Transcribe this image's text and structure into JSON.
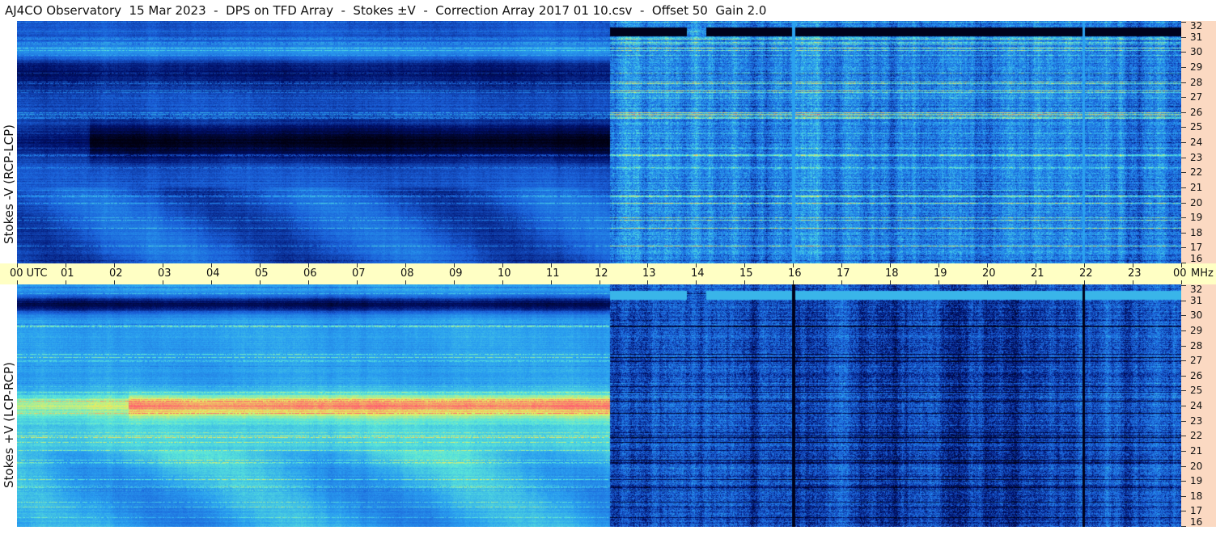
{
  "header": {
    "title": "AJ4CO Observatory  15 Mar 2023  -  DPS on TFD Array  -  Stokes ±V  -  Correction Array 2017 01 10.csv  -  Offset 50  Gain 2.0"
  },
  "chart_data": [
    {
      "type": "heatmap",
      "name": "Stokes -V (RCP-LCP)",
      "ylabel": "Stokes -V (RCP-LCP)",
      "xlabel": "UTC",
      "x_ticks": [
        "00 UTC",
        "01",
        "02",
        "03",
        "04",
        "05",
        "06",
        "07",
        "08",
        "09",
        "10",
        "11",
        "12",
        "13",
        "14",
        "15",
        "16",
        "17",
        "18",
        "19",
        "20",
        "21",
        "22",
        "23",
        "00"
      ],
      "x_range_hours": [
        0,
        24
      ],
      "y_unit": "MHz",
      "y_ticks": [
        16,
        17,
        18,
        19,
        20,
        21,
        22,
        23,
        24,
        25,
        26,
        27,
        28,
        29,
        30,
        31,
        32
      ],
      "y_range_mhz": [
        16,
        32
      ],
      "colormap": [
        "#000010",
        "#00106a",
        "#1a5fd8",
        "#2aa0f0",
        "#5ce8d8",
        "#e8f060",
        "#ff6070"
      ]
    },
    {
      "type": "heatmap",
      "name": "Stokes +V (LCP-RCP)",
      "ylabel": "Stokes +V (LCP-RCP)",
      "xlabel": "UTC",
      "x_ticks": [
        "00 UTC",
        "01",
        "02",
        "03",
        "04",
        "05",
        "06",
        "07",
        "08",
        "09",
        "10",
        "11",
        "12",
        "13",
        "14",
        "15",
        "16",
        "17",
        "18",
        "19",
        "20",
        "21",
        "22",
        "23",
        "00"
      ],
      "x_range_hours": [
        0,
        24
      ],
      "y_unit": "MHz",
      "y_ticks": [
        16,
        17,
        18,
        19,
        20,
        21,
        22,
        23,
        24,
        25,
        26,
        27,
        28,
        29,
        30,
        31,
        32
      ],
      "y_range_mhz": [
        16,
        32
      ],
      "colormap": [
        "#000010",
        "#00106a",
        "#1a5fd8",
        "#2aa0f0",
        "#5ce8d8",
        "#e8f060",
        "#ff6070"
      ]
    }
  ],
  "time_axis": {
    "labels": [
      "00 UTC",
      "01",
      "02",
      "03",
      "04",
      "05",
      "06",
      "07",
      "08",
      "09",
      "10",
      "11",
      "12",
      "13",
      "14",
      "15",
      "16",
      "17",
      "18",
      "19",
      "20",
      "21",
      "22",
      "23",
      "00"
    ],
    "unit": "MHz"
  }
}
